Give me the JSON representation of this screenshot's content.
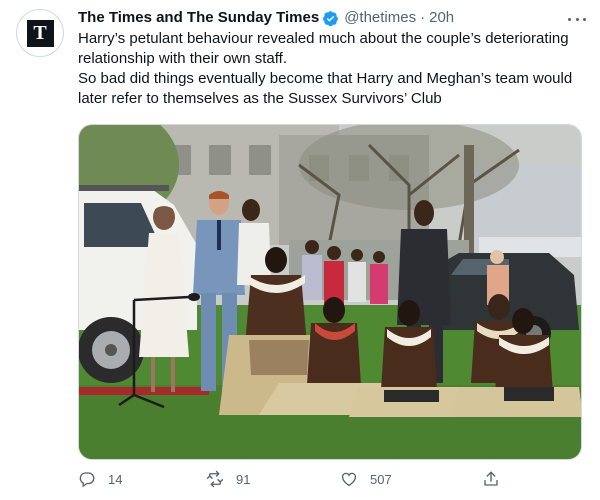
{
  "tweet": {
    "avatar_letter": "T",
    "display_name": "The Times and The Sunday Times",
    "handle": "@thetimes",
    "separator": "·",
    "time": "20h",
    "text": [
      "Harry’s petulant behaviour revealed much about the couple’s deteriorating relationship with their own staff.",
      "So bad did things eventually become that Harry and Meghan’s team would later refer to themselves as the Sussex Survivors’ Club"
    ]
  },
  "actions": {
    "reply_count": "14",
    "retweet_count": "91",
    "like_count": "507"
  },
  "colors": {
    "text": "#0f1419",
    "secondary": "#536471",
    "verified": "#1d9bf0",
    "border": "#cfd9de"
  },
  "icons": [
    "verified-badge-icon",
    "more-icon",
    "reply-icon",
    "retweet-icon",
    "like-icon",
    "share-icon"
  ]
}
